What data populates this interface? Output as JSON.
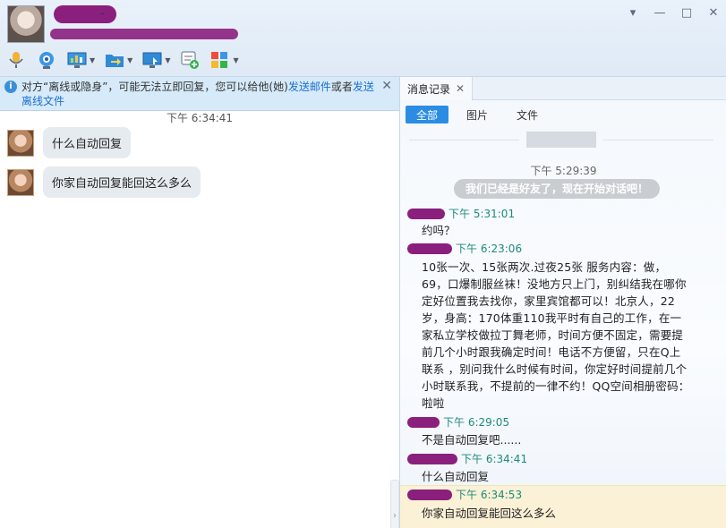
{
  "header": {
    "name_suffix": "-",
    "window_controls": [
      "▾",
      "—",
      "□",
      "✕"
    ]
  },
  "toolbar": {
    "buttons": [
      {
        "name": "voice-call-icon"
      },
      {
        "name": "video-call-icon"
      },
      {
        "name": "remote-desktop-icon"
      },
      {
        "name": "send-file-icon"
      },
      {
        "name": "screen-share-icon"
      },
      {
        "name": "add-app-icon"
      },
      {
        "name": "apps-grid-icon"
      }
    ]
  },
  "notice": {
    "text_before": "对方“离线或隐身”，可能无法立即回复，您可以给他(她)",
    "link_email": "发送邮件",
    "text_mid": "或者",
    "link_file": "发送离线文件",
    "close": "✕"
  },
  "chat": {
    "timestamp": "下午 6:34:41",
    "messages": [
      {
        "text": "什么自动回复"
      },
      {
        "text": "你家自动回复能回这么多么"
      }
    ]
  },
  "history": {
    "tab_label": "消息记录",
    "tab_close": "✕",
    "filters": [
      "全部",
      "图片",
      "文件"
    ],
    "sys_time": "下午 5:29:39",
    "sys_note": "我们已经是好友了，现在开始对话吧！",
    "entries": [
      {
        "time": "下午 5:31:01",
        "text": "约吗？"
      },
      {
        "time": "下午 6:23:06",
        "text": "10张一次、15张两次.过夜25张  服务内容：做，69，口爆制服丝袜！没地方只上门，别纠结我在哪你定好位置我去找你，家里宾馆都可以！北京人，22岁，身高：170体重110我平时有自己的工作，在一家私立学校做拉丁舞老师，时间方便不固定，需要提前几个小时跟我确定时间！电话不方便留，只在Q上联系  ，别问我什么时候有时间，你定好时间提前几个小时联系我，不提前的一律不约！QQ空间相册密码：啦啦"
      },
      {
        "time": "下午 6:29:05",
        "text": "不是自动回复吧......"
      },
      {
        "time": "下午 6:34:41",
        "text": "什么自动回复"
      },
      {
        "time": "下午 6:34:53",
        "text": "你家自动回复能回这么多么"
      }
    ]
  },
  "colors": {
    "accent": "#2b8ce3",
    "redaction": "#8a1f7d",
    "time_green": "#1d8a7a"
  }
}
